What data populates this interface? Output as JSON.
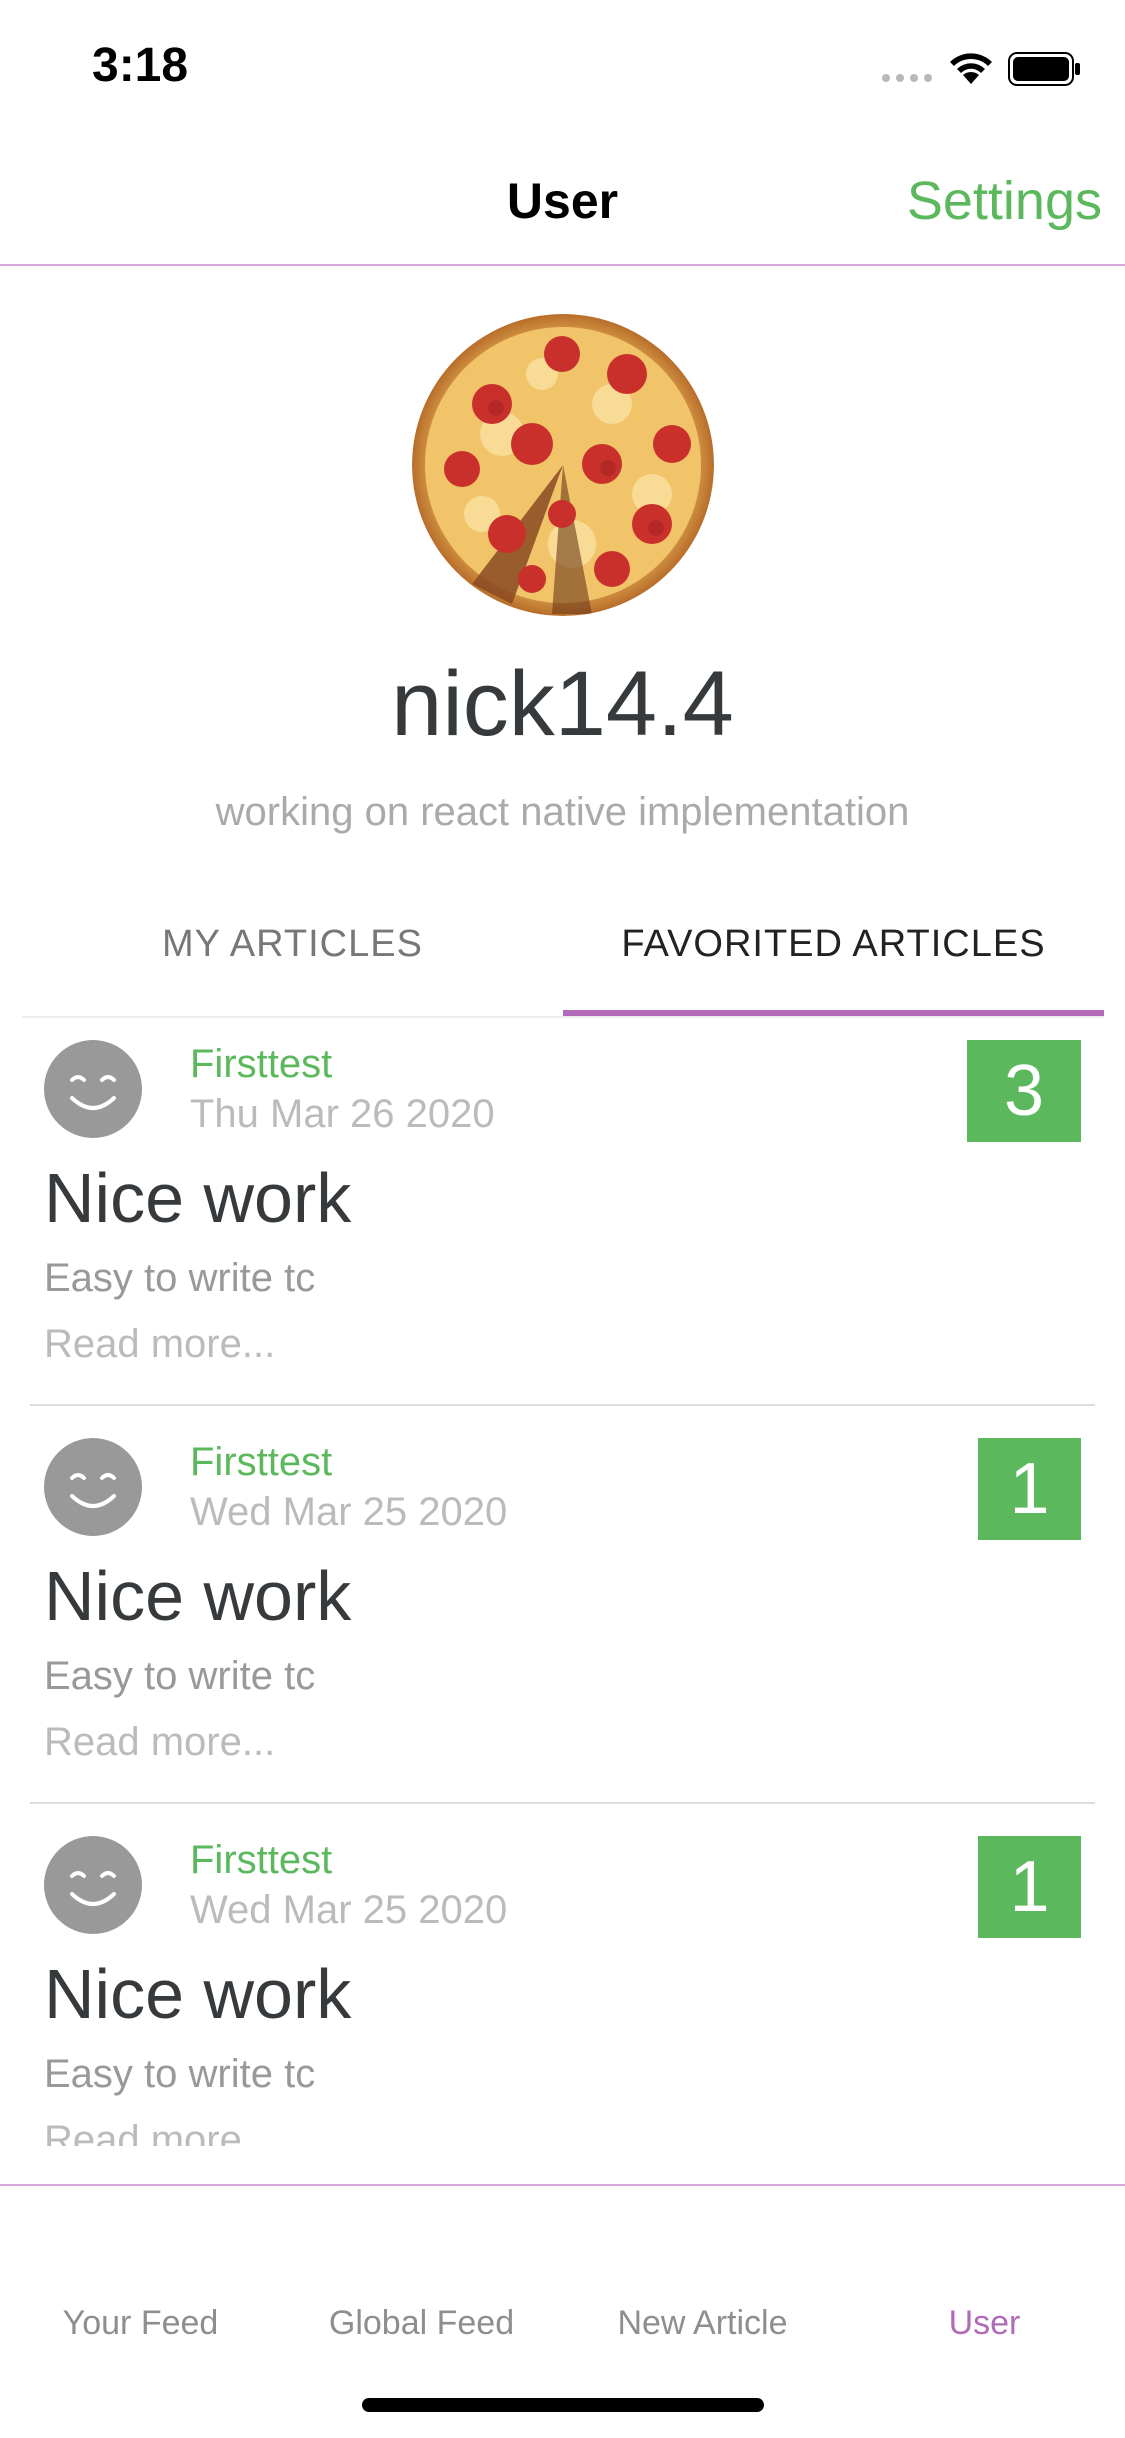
{
  "status_bar": {
    "time": "3:18"
  },
  "nav": {
    "title": "User",
    "settings_label": "Settings"
  },
  "profile": {
    "username": "nick14.4",
    "bio": "working on react native implementation"
  },
  "tabs": [
    {
      "label": "MY ARTICLES",
      "active": false
    },
    {
      "label": "FAVORITED ARTICLES",
      "active": true
    }
  ],
  "articles": [
    {
      "author": "Firsttest",
      "date": "Thu Mar 26 2020",
      "favorites": "3",
      "title": "Nice work",
      "description": "Easy to write tc",
      "read_more": "Read more..."
    },
    {
      "author": "Firsttest",
      "date": "Wed Mar 25 2020",
      "favorites": "1",
      "title": "Nice work",
      "description": "Easy to write tc",
      "read_more": "Read more..."
    },
    {
      "author": "Firsttest",
      "date": "Wed Mar 25 2020",
      "favorites": "1",
      "title": "Nice work",
      "description": "Easy to write tc",
      "read_more": "Read more..."
    }
  ],
  "tab_bar": [
    {
      "label": "Your Feed",
      "active": false
    },
    {
      "label": "Global Feed",
      "active": false
    },
    {
      "label": "New Article",
      "active": false
    },
    {
      "label": "User",
      "active": true
    }
  ],
  "colors": {
    "accent_green": "#5cb85c",
    "accent_purple": "#b06ab8",
    "divider_pink": "#d9a6db"
  },
  "icons": {
    "avatar": "pizza-avatar-icon",
    "author_avatar": "smiley-face-icon"
  }
}
